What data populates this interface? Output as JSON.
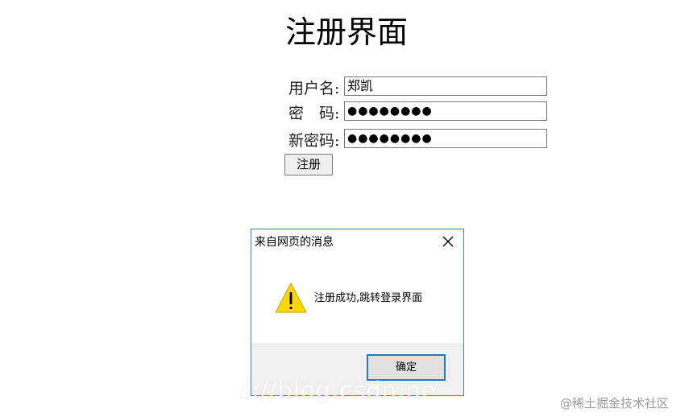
{
  "page": {
    "title": "注册界面",
    "form": {
      "username": {
        "label": "用户名:",
        "value": "郑凯"
      },
      "password": {
        "label": "密　码:",
        "value": "●●●●●●●●"
      },
      "new_password": {
        "label": "新密码:",
        "value": "●●●●●●●●"
      },
      "submit_label": "注册"
    }
  },
  "dialog": {
    "title": "来自网页的消息",
    "message": "注册成功,跳转登录界面",
    "ok_label": "确定",
    "icons": {
      "close": "close-icon",
      "warning": "warning-icon"
    },
    "colors": {
      "border": "#3c7fc9",
      "warning_fill": "#ffd700",
      "ok_border": "#2b75c8"
    }
  },
  "overlay": {
    "url_text": "s://blog.csdn.ne",
    "watermark": "@稀土掘金技术社区"
  }
}
